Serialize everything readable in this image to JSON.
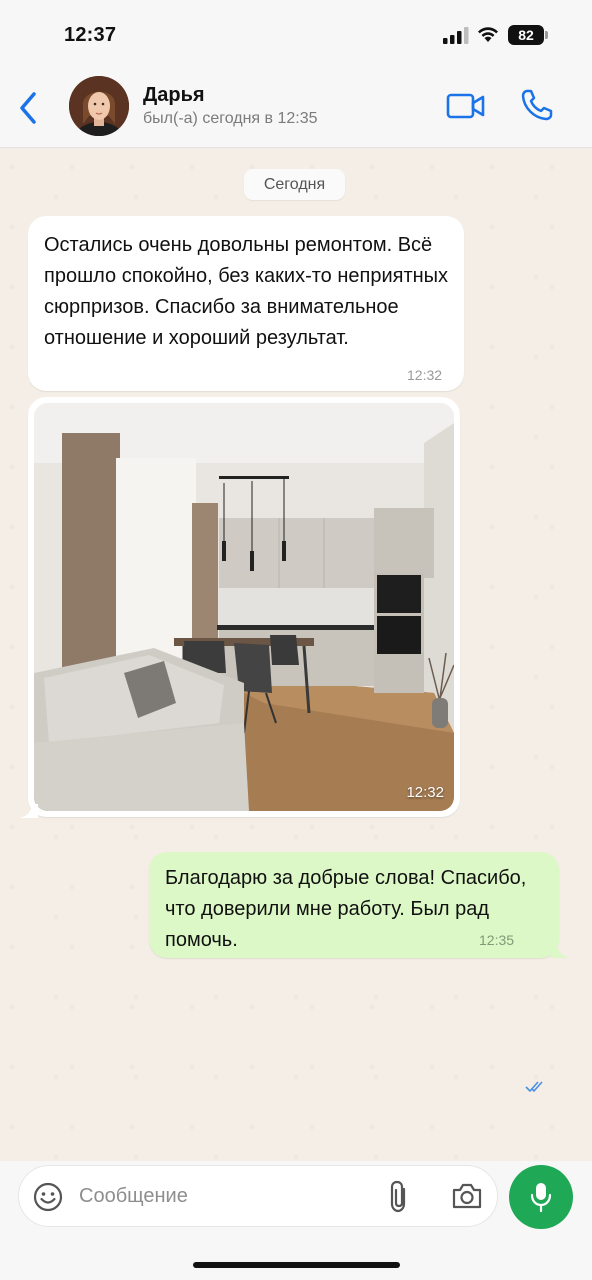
{
  "status_bar": {
    "time": "12:37",
    "battery": "82"
  },
  "header": {
    "contact_name": "Дарья",
    "contact_status": "был(-а) сегодня в 12:35",
    "accent_color": "#1a73e8"
  },
  "chat": {
    "date_chip": "Сегодня",
    "messages": [
      {
        "direction": "in",
        "text": "Остались очень довольны ремонтом. Всё прошло спокойно, без каких-то неприятных сюрпризов. Спасибо за внимательное отношение и хороший результат.",
        "time": "12:32"
      },
      {
        "direction": "in",
        "type": "photo",
        "time": "12:32"
      },
      {
        "direction": "out",
        "text": "Благодарю за добрые слова! Спасибо, что доверили мне работу. Был рад помочь.",
        "time": "12:35",
        "status": "read"
      }
    ]
  },
  "composer": {
    "placeholder": "Сообщение",
    "mic_color": "#1fa855"
  }
}
